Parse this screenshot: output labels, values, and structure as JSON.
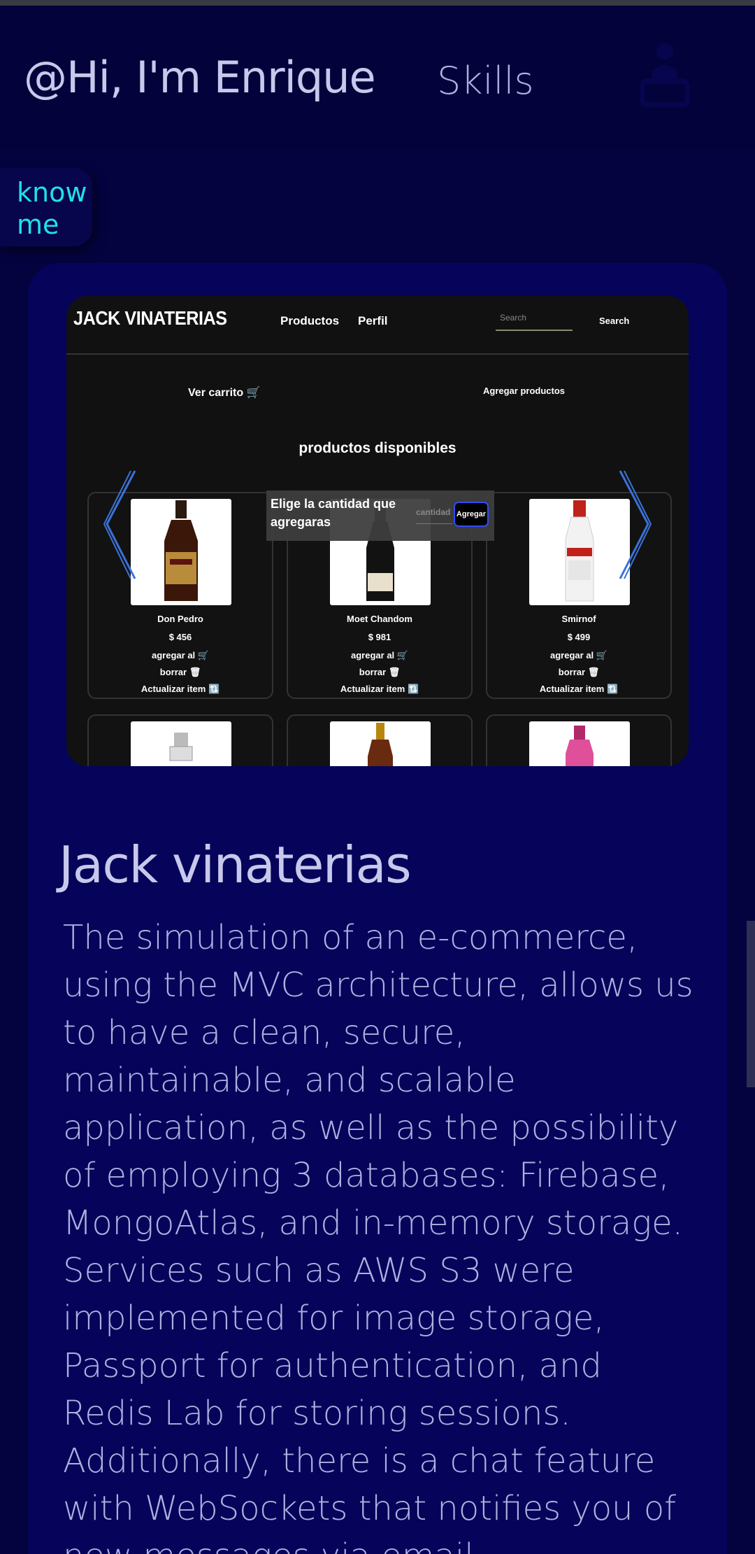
{
  "header": {
    "greeting": "@Hi, I'm Enrique",
    "skills_link": "Skills",
    "icon": "user-laptop-icon"
  },
  "know_me_button": "know me",
  "project": {
    "title": "Jack vinaterias",
    "description": "The simulation of an e-commerce, using the MVC architecture, allows us to have a clean, secure, maintainable, and scalable application, as well as the possibility of employing 3 databases: Firebase, MongoAtlas, and in-memory storage. Services such as AWS S3 were implemented for image storage, Passport for authentication, and Redis Lab for storing sessions. Additionally, there is a chat feature with WebSockets that notifies you of new messages via email.",
    "screenshot": {
      "brand": "JACK VINATERIAS",
      "nav": [
        "Productos",
        "Perfil"
      ],
      "search_placeholder": "Search",
      "search_button": "Search",
      "view_cart": "Ver carrito 🛒",
      "add_products": "Agregar productos",
      "heading": "productos disponibles",
      "popup": {
        "text": "Elige la cantidad que agregaras",
        "input_placeholder": "cantidad",
        "button": "Agregar"
      },
      "products": [
        {
          "name": "Don Pedro",
          "price": "$ 456",
          "add": "agregar al 🛒",
          "delete": "borrar 🗑",
          "update": "Actualizar item 🔃"
        },
        {
          "name": "Moet Chandom",
          "price": "$ 981",
          "add": "agregar al 🛒",
          "delete": "borrar 🗑",
          "update": "Actualizar item 🔃"
        },
        {
          "name": "Smirnof",
          "price": "$ 499",
          "add": "agregar al 🛒",
          "delete": "borrar 🗑",
          "update": "Actualizar item 🔃"
        }
      ]
    }
  },
  "colors": {
    "background": "#04033f",
    "card": "#05045a",
    "accent": "#22e0e8",
    "text": "#c8c8ec"
  }
}
